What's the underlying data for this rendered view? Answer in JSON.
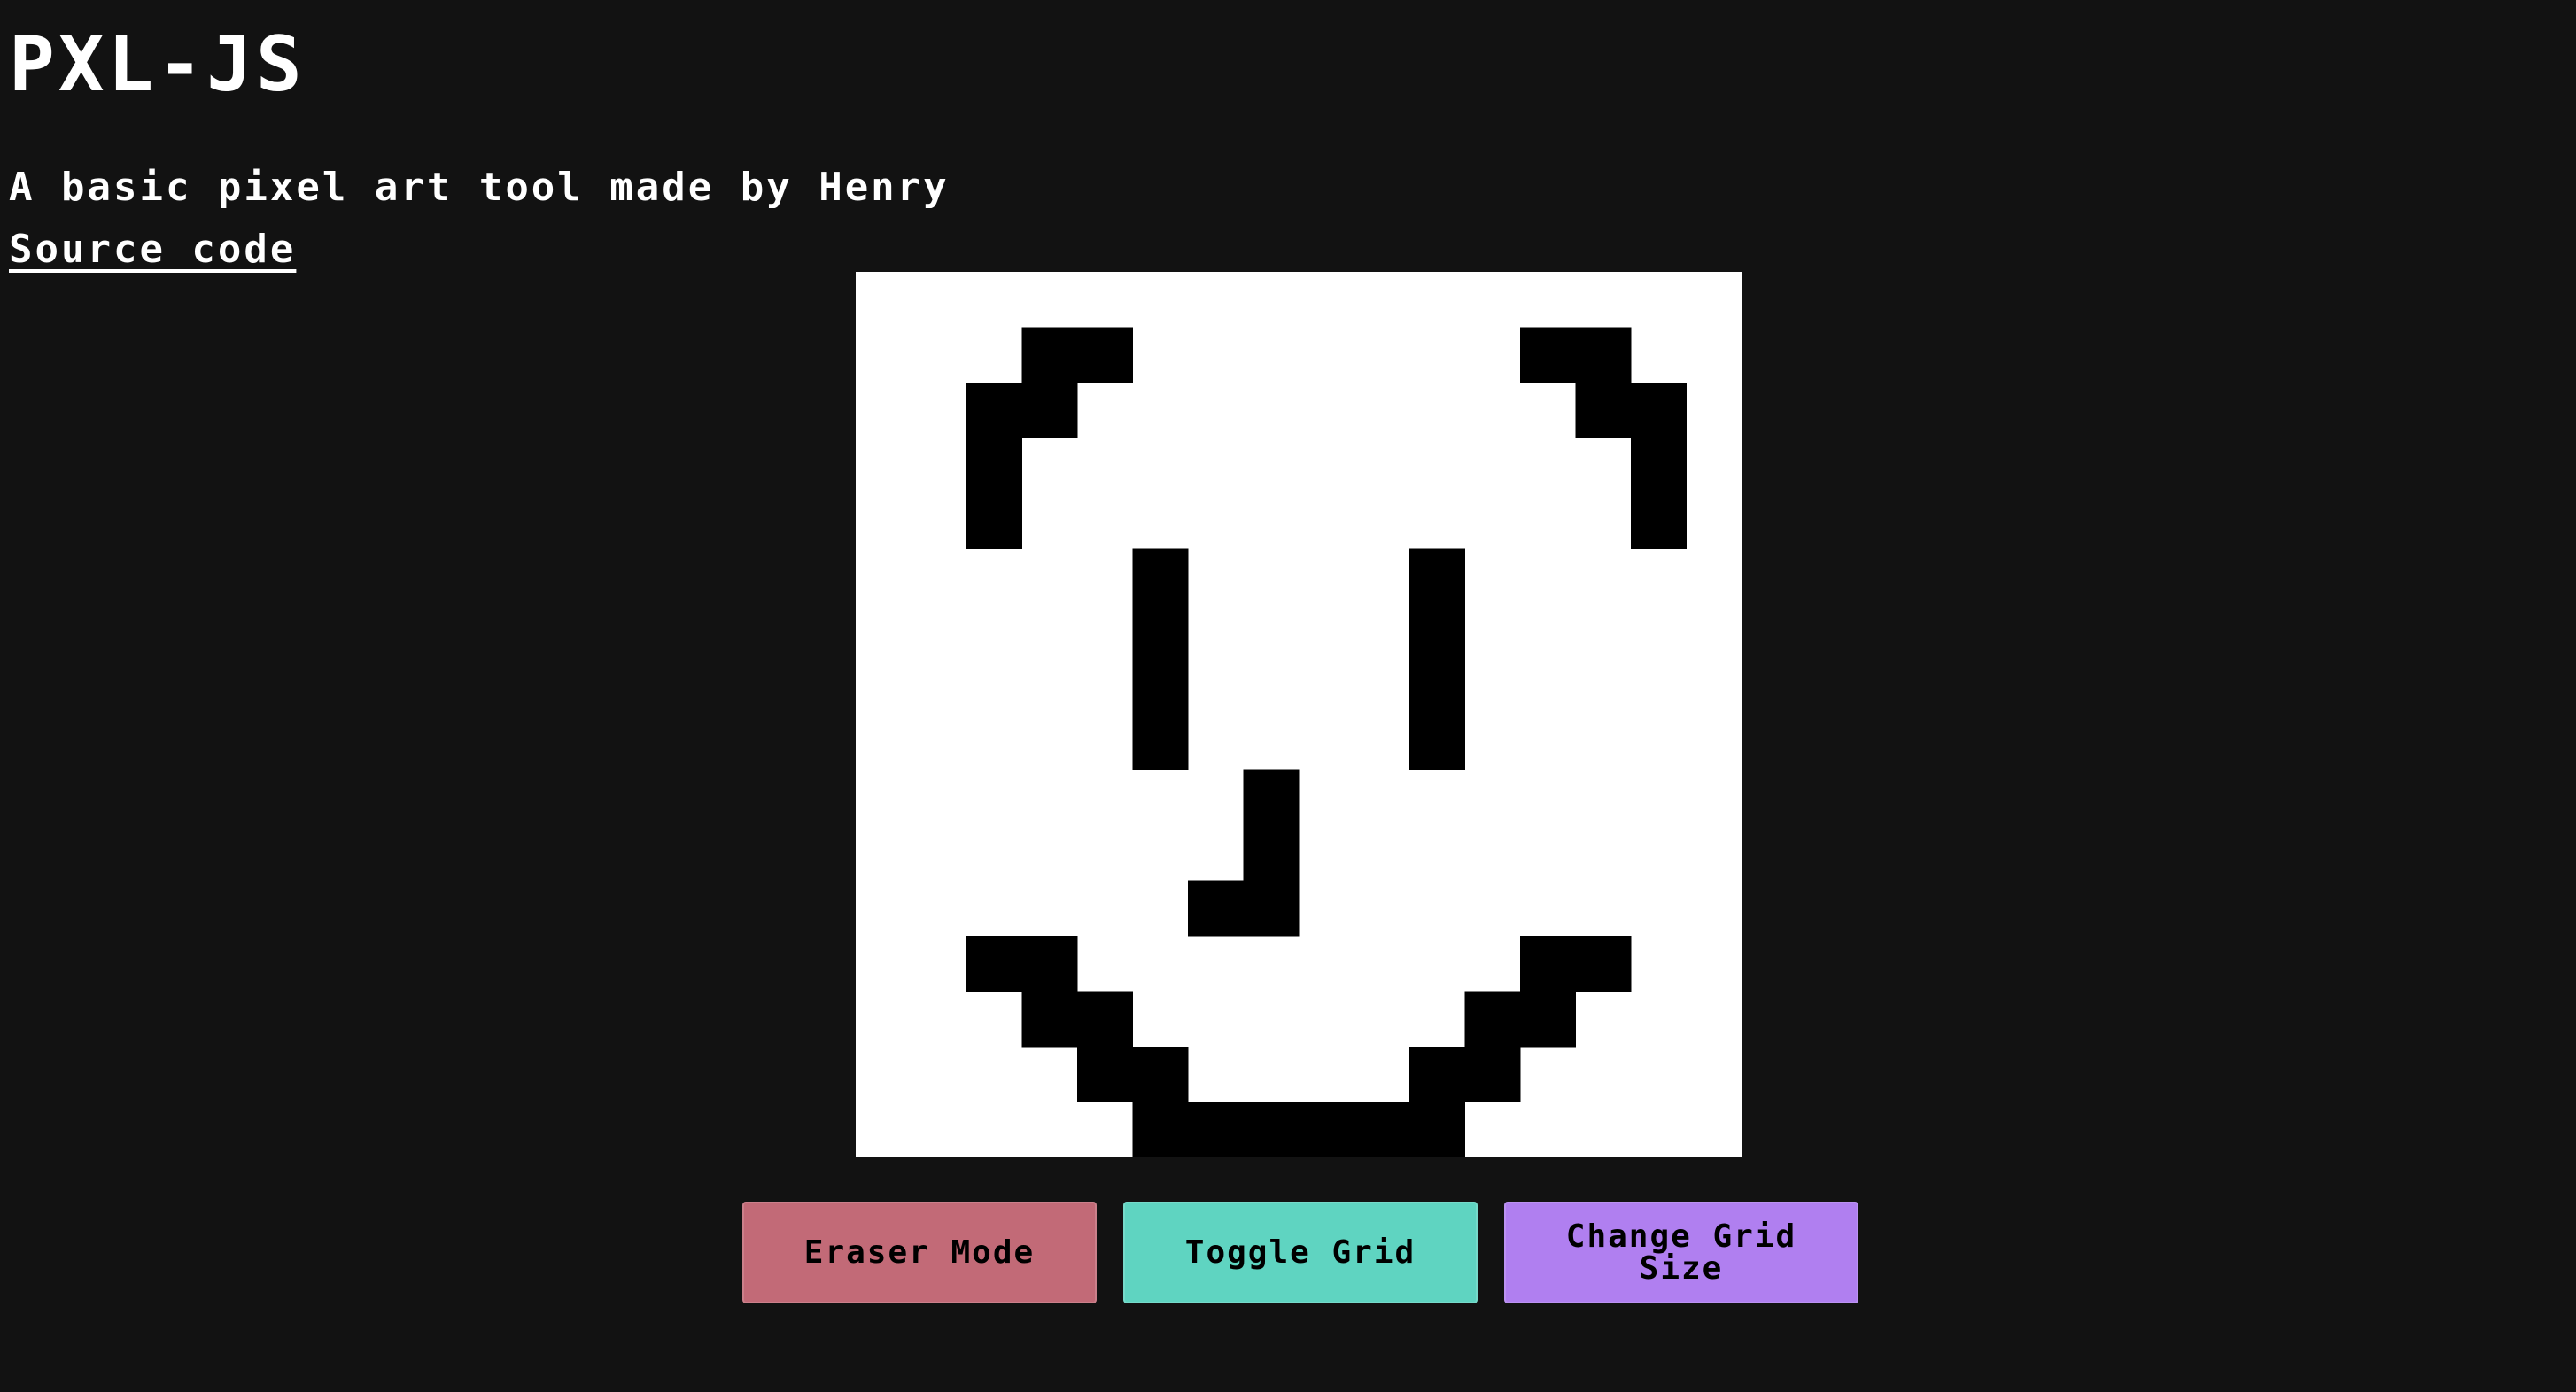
{
  "header": {
    "title": "PXL-JS",
    "subtitle": "A basic pixel art tool made by Henry",
    "source_link": "Source code"
  },
  "canvas": {
    "grid_size": 16,
    "background": "#ffffff",
    "pixel_color": "#000000",
    "filled_pixels": [
      [
        1,
        3
      ],
      [
        1,
        4
      ],
      [
        2,
        2
      ],
      [
        2,
        3
      ],
      [
        3,
        2
      ],
      [
        4,
        2
      ],
      [
        1,
        12
      ],
      [
        1,
        13
      ],
      [
        2,
        13
      ],
      [
        2,
        14
      ],
      [
        3,
        14
      ],
      [
        4,
        14
      ],
      [
        5,
        5
      ],
      [
        6,
        5
      ],
      [
        7,
        5
      ],
      [
        8,
        5
      ],
      [
        5,
        10
      ],
      [
        6,
        10
      ],
      [
        7,
        10
      ],
      [
        8,
        10
      ],
      [
        9,
        7
      ],
      [
        10,
        7
      ],
      [
        11,
        6
      ],
      [
        11,
        7
      ],
      [
        12,
        2
      ],
      [
        12,
        3
      ],
      [
        13,
        3
      ],
      [
        13,
        4
      ],
      [
        14,
        4
      ],
      [
        14,
        5
      ],
      [
        15,
        5
      ],
      [
        15,
        6
      ],
      [
        15,
        7
      ],
      [
        15,
        8
      ],
      [
        15,
        9
      ],
      [
        15,
        10
      ],
      [
        14,
        10
      ],
      [
        14,
        11
      ],
      [
        13,
        11
      ],
      [
        13,
        12
      ],
      [
        12,
        12
      ],
      [
        12,
        13
      ]
    ]
  },
  "controls": {
    "eraser": {
      "label": "Eraser Mode",
      "color": "#c26a77"
    },
    "toggle_grid": {
      "label": "Toggle Grid",
      "color": "#5fd4c1"
    },
    "change_grid": {
      "label": "Change Grid Size",
      "color": "#b07ff0"
    }
  }
}
